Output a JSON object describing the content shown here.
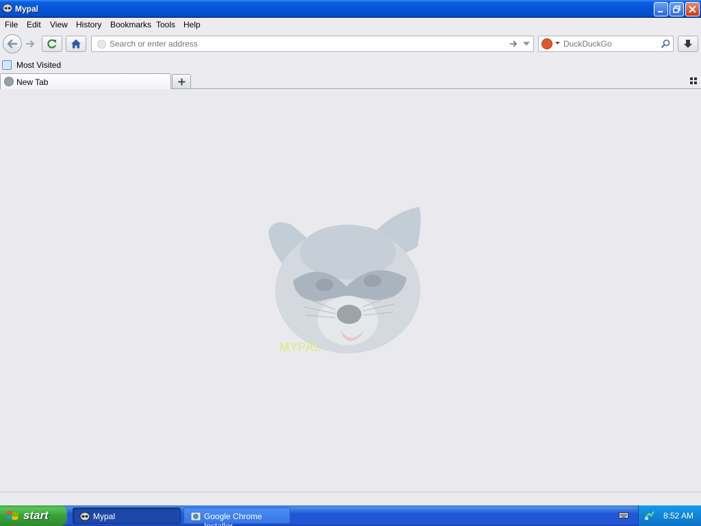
{
  "window": {
    "title": "Mypal"
  },
  "menu": {
    "items": [
      "File",
      "Edit",
      "View",
      "History",
      "Bookmarks",
      "Tools",
      "Help"
    ]
  },
  "navbar": {
    "url_placeholder": "Search or enter address",
    "url_value": "",
    "search_engine": "DuckDuckGo",
    "search_value": ""
  },
  "bookmarks": {
    "items": [
      "Most Visited"
    ]
  },
  "tabs": {
    "items": [
      {
        "label": "New Tab",
        "active": true
      }
    ]
  },
  "content": {
    "logo_icon": "raccoon-logo",
    "logo_text": "MYPAL"
  },
  "taskbar": {
    "start_label": "start",
    "tasks": [
      {
        "label": "Mypal",
        "active": true
      },
      {
        "label": "Google Chrome Installer",
        "active": false
      }
    ],
    "clock": "8:52 AM"
  },
  "colors": {
    "titlebar_blue": "#0455d6",
    "start_green": "#37a237",
    "content_bg": "#eaeaee"
  }
}
